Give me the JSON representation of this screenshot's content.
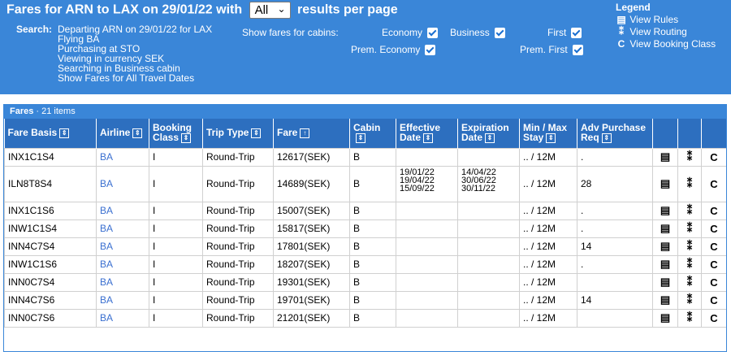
{
  "header": {
    "title_prefix": "Fares for ARN to LAX on 29/01/22 with",
    "per_page_value": "All",
    "title_suffix": "results per page",
    "search_label": "Search:",
    "search_lines": [
      "Departing ARN on 29/01/22 for LAX",
      "Flying BA",
      "Purchasing at STO",
      "Viewing in currency SEK",
      "Searching in Business cabin",
      "Show Fares for All Travel Dates"
    ],
    "cabins_label": "Show fares for cabins:",
    "cabins": [
      "Economy",
      "Business",
      "First",
      "Prem. Economy",
      "Prem. First"
    ]
  },
  "legend": {
    "title": "Legend",
    "items": [
      {
        "label": "View Rules",
        "icon": "rules-icon"
      },
      {
        "label": "View Routing",
        "icon": "routing-icon"
      },
      {
        "label": "View Booking Class",
        "icon": "booking-class-icon"
      }
    ]
  },
  "panel": {
    "title": "Fares",
    "count": "21 items"
  },
  "columns": [
    {
      "line1": "Fare Basis",
      "line2": ""
    },
    {
      "line1": "Airline",
      "line2": ""
    },
    {
      "line1": "Booking",
      "line2": "Class"
    },
    {
      "line1": "Trip Type",
      "line2": ""
    },
    {
      "line1": "Fare",
      "line2": ""
    },
    {
      "line1": "Cabin",
      "line2": ""
    },
    {
      "line1": "Effective",
      "line2": "Date"
    },
    {
      "line1": "Expiration",
      "line2": "Date"
    },
    {
      "line1": "Min / Max",
      "line2": "Stay"
    },
    {
      "line1": "Adv Purchase",
      "line2": "Req"
    }
  ],
  "rows": [
    {
      "basis": "INX1C1S4",
      "airline": "BA",
      "class": "I",
      "trip": "Round-Trip",
      "fare": "12617(SEK)",
      "cabin": "B",
      "eff": "",
      "exp": "",
      "stay": ".. / 12M",
      "adv": "."
    },
    {
      "basis": "ILN8T8S4",
      "airline": "BA",
      "class": "I",
      "trip": "Round-Trip",
      "fare": "14689(SEK)",
      "cabin": "B",
      "eff": "19/01/22\n19/04/22\n15/09/22",
      "exp": "14/04/22\n30/06/22\n30/11/22",
      "stay": ".. / 12M",
      "adv": "28"
    },
    {
      "basis": "INX1C1S6",
      "airline": "BA",
      "class": "I",
      "trip": "Round-Trip",
      "fare": "15007(SEK)",
      "cabin": "B",
      "eff": "",
      "exp": "",
      "stay": ".. / 12M",
      "adv": "."
    },
    {
      "basis": "INW1C1S4",
      "airline": "BA",
      "class": "I",
      "trip": "Round-Trip",
      "fare": "15817(SEK)",
      "cabin": "B",
      "eff": "",
      "exp": "",
      "stay": ".. / 12M",
      "adv": "."
    },
    {
      "basis": "INN4C7S4",
      "airline": "BA",
      "class": "I",
      "trip": "Round-Trip",
      "fare": "17801(SEK)",
      "cabin": "B",
      "eff": "",
      "exp": "",
      "stay": ".. / 12M",
      "adv": "14"
    },
    {
      "basis": "INW1C1S6",
      "airline": "BA",
      "class": "I",
      "trip": "Round-Trip",
      "fare": "18207(SEK)",
      "cabin": "B",
      "eff": "",
      "exp": "",
      "stay": ".. / 12M",
      "adv": "."
    },
    {
      "basis": "INN0C7S4",
      "airline": "BA",
      "class": "I",
      "trip": "Round-Trip",
      "fare": "19301(SEK)",
      "cabin": "B",
      "eff": "",
      "exp": "",
      "stay": ".. / 12M",
      "adv": ""
    },
    {
      "basis": "INN4C7S6",
      "airline": "BA",
      "class": "I",
      "trip": "Round-Trip",
      "fare": "19701(SEK)",
      "cabin": "B",
      "eff": "",
      "exp": "",
      "stay": ".. / 12M",
      "adv": "14"
    },
    {
      "basis": "INN0C7S6",
      "airline": "BA",
      "class": "I",
      "trip": "Round-Trip",
      "fare": "21201(SEK)",
      "cabin": "B",
      "eff": "",
      "exp": "",
      "stay": ".. / 12M",
      "adv": ""
    }
  ],
  "colors": {
    "header_bg": "#3a86d8",
    "th_bg": "#2d6fbf",
    "link": "#3a6fd0"
  }
}
